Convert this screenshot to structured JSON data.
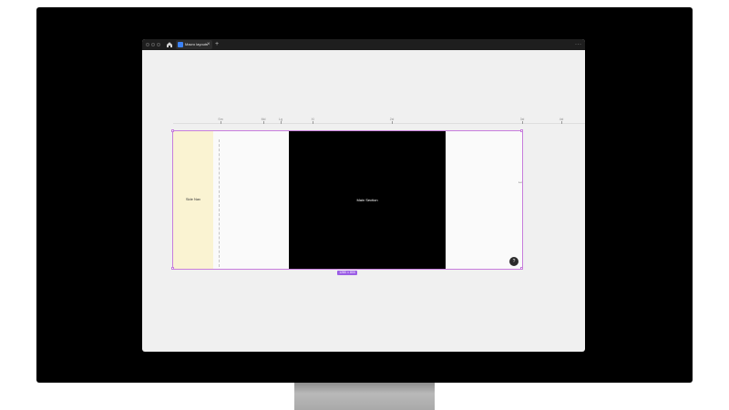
{
  "window": {
    "tab_title": "Macro layouts",
    "tab_close": "×",
    "add_tab": "+",
    "more_menu": "···"
  },
  "breakpoints": [
    {
      "label": "Sm"
    },
    {
      "label": "Md"
    },
    {
      "label": "Lg"
    },
    {
      "label": "Xl"
    },
    {
      "label": "2xl"
    },
    {
      "label": "3xl"
    },
    {
      "label": "4xl"
    }
  ],
  "canvas": {
    "side_nav_label": "Side Nav",
    "main_section_label": "Main Section",
    "size_badge": "1280 × 800",
    "help_glyph": "?",
    "resize_glyph": "↔"
  },
  "colors": {
    "side_nav": "#faf3d2",
    "main_section": "#000000",
    "selection": "#c77ddc",
    "badge": "#9b5de5"
  },
  "icons": [
    "home-icon",
    "file-icon",
    "close-icon",
    "plus-icon",
    "more-icon",
    "help-icon",
    "resize-icon"
  ]
}
